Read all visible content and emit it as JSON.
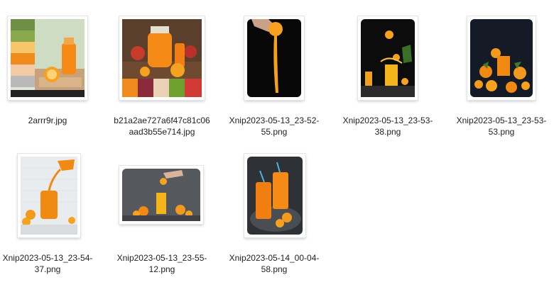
{
  "files": [
    {
      "name": "2arrr9r.jpg"
    },
    {
      "name": "b21a2ae727a6f47c81c06\naad3b55e714.jpg"
    },
    {
      "name": "Xnip2023-05-13_23-52-\n55.png"
    },
    {
      "name": "Xnip2023-05-13_23-53-\n38.png"
    },
    {
      "name": "Xnip2023-05-13_23-53-\n53.png"
    },
    {
      "name": "Xnip2023-05-13_23-54-\n37.png"
    },
    {
      "name": "Xnip2023-05-13_23-55-\n12.png"
    },
    {
      "name": "Xnip2023-05-14_00-04-\n58.png"
    }
  ],
  "colors": {
    "orange": "#f08a1c",
    "juice": "#f57e12",
    "label_text": "#1f1f1f"
  }
}
